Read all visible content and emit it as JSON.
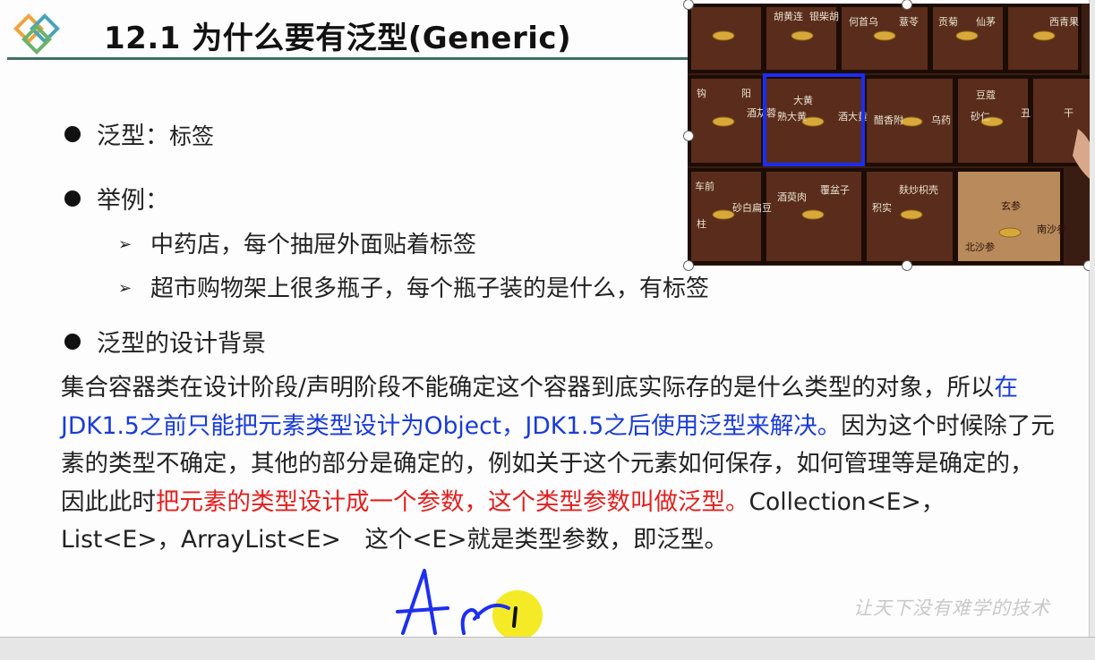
{
  "slide": {
    "title": "12.1 为什么要有泛型(Generic)",
    "bullets": [
      {
        "label": "泛型：",
        "text": "标签"
      },
      {
        "label": "举例：",
        "text": ""
      },
      {
        "label": "泛型的设计背景",
        "text": ""
      }
    ],
    "examples": [
      "中药店，每个抽屉外面贴着标签",
      "超市购物架上很多瓶子，每个瓶子装的是什么，有标签"
    ],
    "paragraph": {
      "s1": "集合容器类在设计阶段/声明阶段不能确定这个容器到底实际存的是什么类型的对象，所以",
      "s2_blue": "在JDK1.5之前只能把元素类型设计为Object，JDK1.5之后使用泛型来解决。",
      "s3": "因为这个时候除了元素的类型不确定，其他的部分是确定的，例如关于这个元素如何保存，如何管理等是确定的，因此此时",
      "s4_red": "把元素的类型设计成一个参数，这个类型参数叫做泛型。",
      "s5": "Collection<E>，List<E>，ArrayList<E>　这个<E>就是类型参数，即泛型。"
    },
    "photo": {
      "alt": "中药柜抽屉",
      "labels": {
        "top": [
          "胡黄连",
          "银柴胡",
          "何首乌",
          "薏苓",
          "贡菊",
          "仙茅",
          "西青果"
        ],
        "mid": [
          "钩",
          "阳",
          "酒苁蓉",
          "大黄",
          "熟大黄",
          "酒大黄",
          "醋香附",
          "乌药",
          "豆蔻",
          "砂仁",
          "丑",
          "干"
        ],
        "low": [
          "车前",
          "柱",
          "砂白扁豆",
          "酒萸肉",
          "覆盆子",
          "积实",
          "麸炒枳壳",
          "北沙参",
          "南沙参",
          "玄参"
        ]
      }
    },
    "watermark": "让天下没有难学的技术",
    "handwriting": "Ary"
  },
  "colors": {
    "title_rule": "#3f6f63",
    "highlight_blue": "#1a3bd6",
    "highlight_red": "#e02020",
    "photo_selection": "#1a2ef0",
    "pointer": "#f2e600"
  }
}
